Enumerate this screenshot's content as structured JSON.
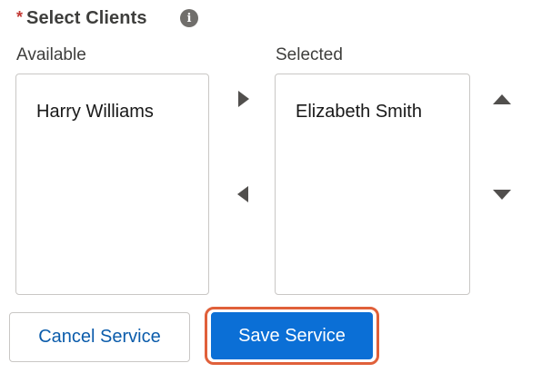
{
  "header": {
    "required_mark": "*",
    "title": "Select Clients",
    "info_icon_glyph": "i"
  },
  "available": {
    "label": "Available",
    "options": [
      "Harry Williams"
    ]
  },
  "selected": {
    "label": "Selected",
    "options": [
      "Elizabeth Smith"
    ]
  },
  "controls": {
    "move_right_icon": "triangle-right",
    "move_left_icon": "triangle-left",
    "move_up_icon": "triangle-up",
    "move_down_icon": "triangle-down"
  },
  "footer": {
    "cancel_label": "Cancel Service",
    "save_label": "Save Service"
  },
  "colors": {
    "required": "#c23934",
    "brand_blue": "#0b6fd6",
    "link_blue": "#0b5cab",
    "focus_outline": "#e0603a"
  }
}
